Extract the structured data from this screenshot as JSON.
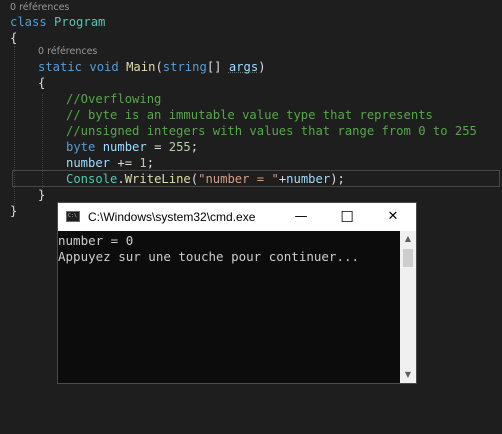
{
  "editor": {
    "codelens1": "0 références",
    "codelens2": "0 références",
    "line_class": {
      "kw": "class",
      "name": "Program"
    },
    "brace_open1": "{",
    "line_main": {
      "static": "static",
      "void": "void",
      "name": "Main",
      "paren_open": "(",
      "type": "string",
      "brackets": "[] ",
      "param": "args",
      "paren_close": ")"
    },
    "brace_open2": "{",
    "comment1": "//Overflowing",
    "comment2": "// byte is an immutable value type that represents",
    "comment3": "//unsigned integers with values that range from 0 to 255",
    "line_byte": {
      "kw": "byte",
      "var": "number",
      "eq": " = ",
      "num": "255",
      "end": ";"
    },
    "line_inc": {
      "var": "number",
      "op": " += ",
      "num": "1",
      "end": ";"
    },
    "line_console": {
      "cls": "Console",
      "dot": ".",
      "method": "WriteLine",
      "open": "(",
      "str": "\"number = \"",
      "plus": "+",
      "var": "number",
      "close": ");"
    },
    "brace_close2": "}",
    "brace_close1": "}"
  },
  "cmd_window": {
    "title": "C:\\Windows\\system32\\cmd.exe",
    "icon_text": "C:\\",
    "minimize": "—",
    "maximize": "☐",
    "close": "✕",
    "output": [
      "number = 0",
      "Appuyez sur une touche pour continuer..."
    ],
    "scroll_up": "▲",
    "scroll_down": "▼"
  }
}
